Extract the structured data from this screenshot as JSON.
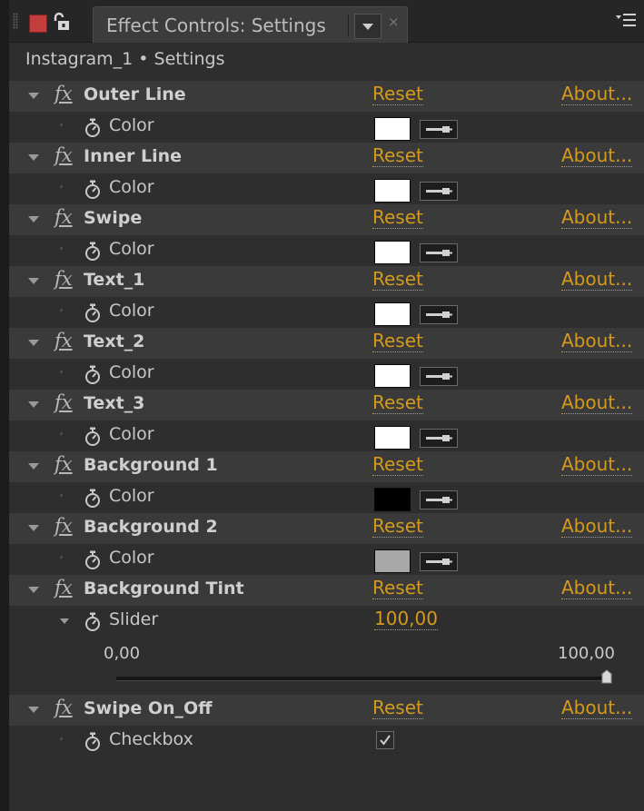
{
  "tab": {
    "title": "Effect Controls: Settings",
    "close_glyph": "×"
  },
  "breadcrumb": "Instagram_1 • Settings",
  "labels": {
    "fx": "fx",
    "reset": "Reset",
    "about": "About..."
  },
  "effects": [
    {
      "name": "Outer Line",
      "param": "Color",
      "color": "#ffffff"
    },
    {
      "name": "Inner Line",
      "param": "Color",
      "color": "#ffffff"
    },
    {
      "name": "Swipe",
      "param": "Color",
      "color": "#ffffff"
    },
    {
      "name": "Text_1",
      "param": "Color",
      "color": "#ffffff"
    },
    {
      "name": "Text_2",
      "param": "Color",
      "color": "#ffffff"
    },
    {
      "name": "Text_3",
      "param": "Color",
      "color": "#ffffff"
    },
    {
      "name": "Background 1",
      "param": "Color",
      "color": "#000000"
    },
    {
      "name": "Background 2",
      "param": "Color",
      "color": "#a8a8a8"
    }
  ],
  "tint": {
    "name": "Background Tint",
    "param": "Slider",
    "value": "100,00",
    "min": "0,00",
    "max": "100,00",
    "fraction": 1.0
  },
  "swipe_toggle": {
    "name": "Swipe On_Off",
    "param": "Checkbox",
    "checked": true
  },
  "colors": {
    "accent": "#d39a1c",
    "panel_bg": "#2e2e2e",
    "header_row_bg": "#3a3a3a"
  }
}
